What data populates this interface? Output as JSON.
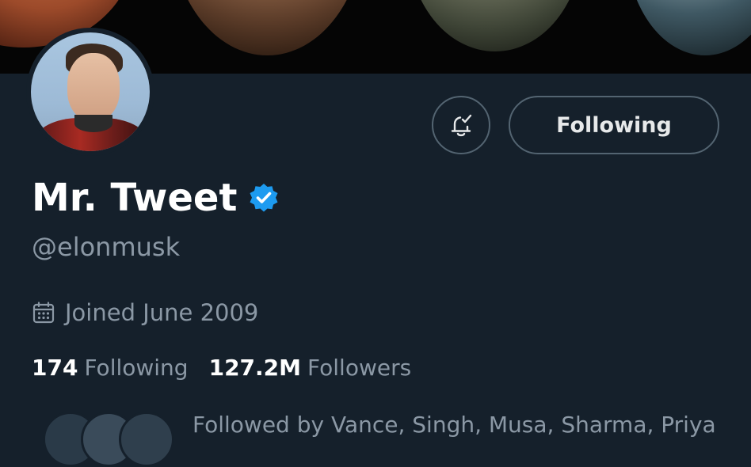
{
  "profile": {
    "name": "Mr. Tweet",
    "handle": "@elonmusk",
    "joined": "Joined June 2009",
    "follow_button_label": "Following",
    "following_count": "174",
    "following_label": "Following",
    "followers_count": "127.2M",
    "followers_label": "Followers",
    "followed_by_text": "Followed by Vance, Singh, Musa, Sharma, Priya"
  },
  "icons": {
    "bell": "bell-check-icon",
    "verified": "verified-badge-icon",
    "calendar": "calendar-icon"
  },
  "colors": {
    "background": "#15202b",
    "verified_blue": "#1d9bf0",
    "secondary_text": "#8b98a5",
    "border": "#536471"
  }
}
